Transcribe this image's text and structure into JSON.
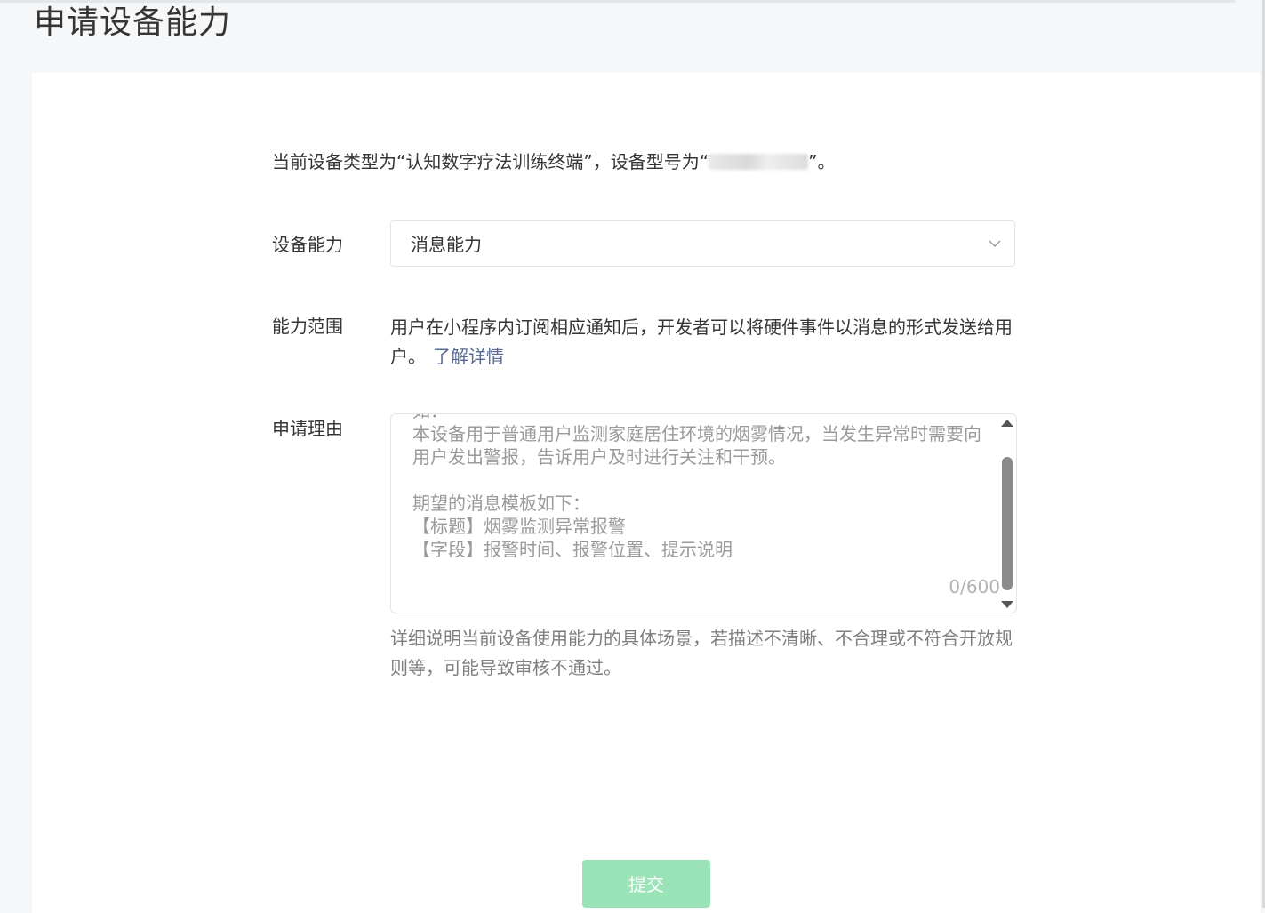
{
  "page": {
    "title": "申请设备能力"
  },
  "intro": {
    "prefix": "当前设备类型为“认知数字疗法训练终端”，设备型号为“",
    "suffix": "”。"
  },
  "form": {
    "capability": {
      "label": "设备能力",
      "selected": "消息能力"
    },
    "scope": {
      "label": "能力范围",
      "text": "用户在小程序内订阅相应通知后，开发者可以将硬件事件以消息的形式发送给用户。",
      "link": "了解详情"
    },
    "reason": {
      "label": "申请理由",
      "placeholder_lines": [
        "如：",
        "本设备用于普通用户监测家庭居住环境的烟雾情况，当发生异常时需要向用户发出警报，告诉用户及时进行关注和干预。",
        "期望的消息模板如下：",
        "【标题】烟雾监测异常报警",
        "【字段】报警时间、报警位置、提示说明"
      ],
      "counter": "0/600",
      "hint": "详细说明当前设备使用能力的具体场景，若描述不清晰、不合理或不符合开放规则等，可能导致审核不通过。"
    }
  },
  "actions": {
    "submit_label": "提交",
    "submit_color": "#8fe0b0"
  },
  "colors": {
    "link": "#576b95",
    "text": "#353535",
    "placeholder": "#9a9a9a"
  },
  "icons": {
    "select_chevron": "chevron-down-icon",
    "scroll_up": "scroll-up-arrow-icon",
    "scroll_down": "scroll-down-arrow-icon"
  }
}
